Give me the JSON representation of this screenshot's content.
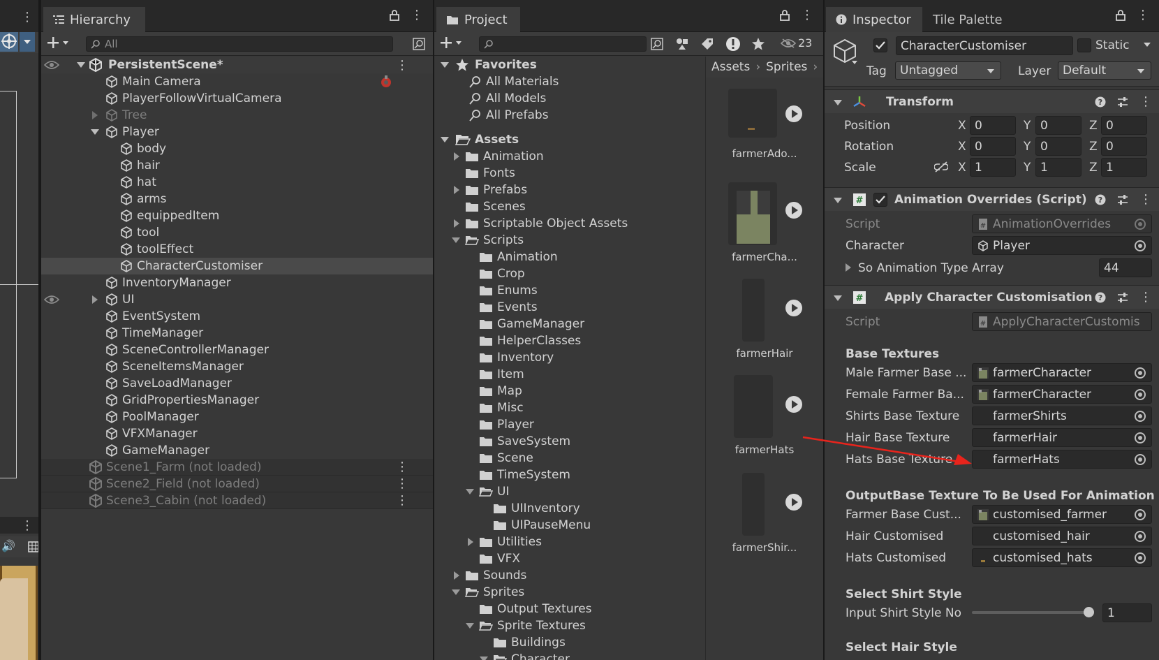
{
  "hierarchy": {
    "tab_label": "Hierarchy",
    "search_placeholder": "All",
    "scene_name": "PersistentScene*",
    "items": [
      {
        "label": "Main Camera"
      },
      {
        "label": "PlayerFollowVirtualCamera"
      },
      {
        "label": "Tree"
      },
      {
        "label": "Player"
      },
      {
        "label": "body"
      },
      {
        "label": "hair"
      },
      {
        "label": "hat"
      },
      {
        "label": "arms"
      },
      {
        "label": "equippedItem"
      },
      {
        "label": "tool"
      },
      {
        "label": "toolEffect"
      },
      {
        "label": "CharacterCustomiser"
      },
      {
        "label": "InventoryManager"
      },
      {
        "label": "UI"
      },
      {
        "label": "EventSystem"
      },
      {
        "label": "TimeManager"
      },
      {
        "label": "SceneControllerManager"
      },
      {
        "label": "SceneItemsManager"
      },
      {
        "label": "SaveLoadManager"
      },
      {
        "label": "GridPropertiesManager"
      },
      {
        "label": "PoolManager"
      },
      {
        "label": "VFXManager"
      },
      {
        "label": "GameManager"
      }
    ],
    "unloaded_scenes": [
      {
        "label": "Scene1_Farm (not loaded)"
      },
      {
        "label": "Scene2_Field (not loaded)"
      },
      {
        "label": "Scene3_Cabin (not loaded)"
      }
    ]
  },
  "project": {
    "tab_label": "Project",
    "hidden_count": "23",
    "breadcrumb": [
      "Assets",
      "Sprites"
    ],
    "favorites_label": "Favorites",
    "favorites": [
      {
        "label": "All Materials"
      },
      {
        "label": "All Models"
      },
      {
        "label": "All Prefabs"
      }
    ],
    "assets_label": "Assets",
    "tree": [
      {
        "label": "Animation"
      },
      {
        "label": "Fonts"
      },
      {
        "label": "Prefabs"
      },
      {
        "label": "Scenes"
      },
      {
        "label": "Scriptable Object Assets"
      },
      {
        "label": "Scripts"
      },
      {
        "label": "Animation"
      },
      {
        "label": "Crop"
      },
      {
        "label": "Enums"
      },
      {
        "label": "Events"
      },
      {
        "label": "GameManager"
      },
      {
        "label": "HelperClasses"
      },
      {
        "label": "Inventory"
      },
      {
        "label": "Item"
      },
      {
        "label": "Map"
      },
      {
        "label": "Misc"
      },
      {
        "label": "Player"
      },
      {
        "label": "SaveSystem"
      },
      {
        "label": "Scene"
      },
      {
        "label": "TimeSystem"
      },
      {
        "label": "UI"
      },
      {
        "label": "UIInventory"
      },
      {
        "label": "UIPauseMenu"
      },
      {
        "label": "Utilities"
      },
      {
        "label": "VFX"
      },
      {
        "label": "Sounds"
      },
      {
        "label": "Sprites"
      },
      {
        "label": "Output Textures"
      },
      {
        "label": "Sprite Textures"
      },
      {
        "label": "Buildings"
      },
      {
        "label": "Character"
      }
    ],
    "thumbnails": [
      {
        "label": "farmerAdo..."
      },
      {
        "label": "farmerCha..."
      },
      {
        "label": "farmerHair"
      },
      {
        "label": "farmerHats"
      },
      {
        "label": "farmerShir..."
      }
    ]
  },
  "inspector": {
    "tab_label": "Inspector",
    "tab2_label": "Tile Palette",
    "object_name": "CharacterCustomiser",
    "static_label": "Static",
    "tag_label": "Tag",
    "tag_value": "Untagged",
    "layer_label": "Layer",
    "layer_value": "Default",
    "transform": {
      "title": "Transform",
      "position_label": "Position",
      "rotation_label": "Rotation",
      "scale_label": "Scale",
      "x": "X",
      "y": "Y",
      "z": "Z",
      "position": [
        "0",
        "0",
        "0"
      ],
      "rotation": [
        "0",
        "0",
        "0"
      ],
      "scale": [
        "1",
        "1",
        "1"
      ]
    },
    "anim_overrides": {
      "title": "Animation Overrides (Script)",
      "script_label": "Script",
      "script_value": "AnimationOverrides",
      "character_label": "Character",
      "character_value": "Player",
      "array_label": "So Animation Type Array",
      "array_value": "44"
    },
    "apply_custom": {
      "title": "Apply Character Customisation",
      "script_label": "Script",
      "script_value": "ApplyCharacterCustomis",
      "base_textures_header": "Base Textures",
      "male_label": "Male Farmer Base ...",
      "male_value": "farmerCharacter",
      "female_label": "Female Farmer Ba...",
      "female_value": "farmerCharacter",
      "shirts_label": "Shirts Base Texture",
      "shirts_value": "farmerShirts",
      "hair_label": "Hair Base Texture",
      "hair_value": "farmerHair",
      "hats_label": "Hats Base Texture",
      "hats_value": "farmerHats",
      "output_header": "OutputBase Texture To Be Used For Animation",
      "farmer_out_label": "Farmer Base Cust...",
      "farmer_out_value": "customised_farmer",
      "hair_out_label": "Hair Customised",
      "hair_out_value": "customised_hair",
      "hats_out_label": "Hats Customised",
      "hats_out_value": "customised_hats",
      "shirt_header": "Select Shirt Style",
      "shirt_input_label": "Input Shirt Style No",
      "shirt_input_value": "1",
      "shirt_slider_fraction": 1.0,
      "hair_header": "Select Hair Style"
    }
  },
  "colors": {
    "panel": "#383838",
    "annotation_arrow": "#e8241c",
    "icon_white": "#d8d8d8"
  }
}
